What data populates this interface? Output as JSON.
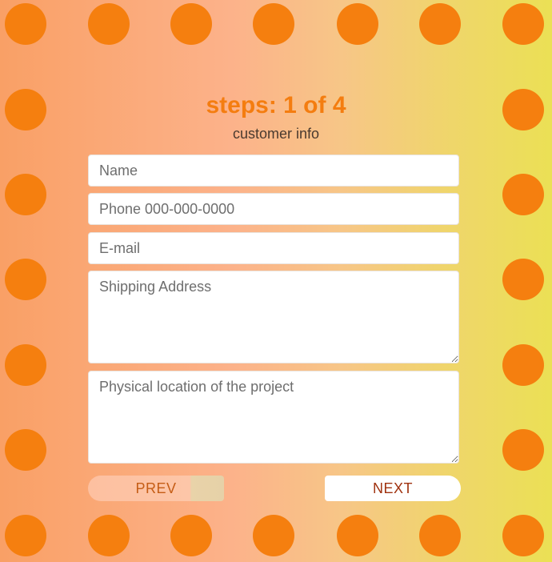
{
  "header": {
    "title": "steps: 1 of 4",
    "subtitle": "customer info"
  },
  "form": {
    "name_placeholder": "Name",
    "phone_placeholder": "Phone 000-000-0000",
    "email_placeholder": "E-mail",
    "shipping_placeholder": "Shipping Address",
    "location_placeholder": "Physical location of the project"
  },
  "buttons": {
    "prev_label": "PREV",
    "next_label": "NEXT"
  },
  "colors": {
    "accent": "#f57f0f",
    "title": "#f47d10"
  }
}
